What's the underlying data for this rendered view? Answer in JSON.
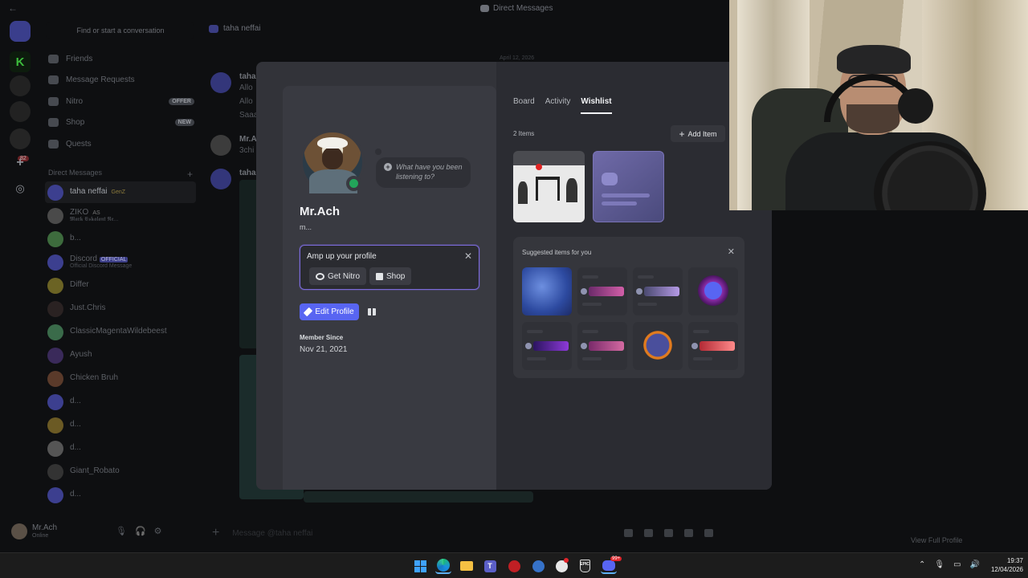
{
  "window": {
    "title": "Direct Messages"
  },
  "sidebar": {
    "search_placeholder": "Find or start a conversation",
    "nav": [
      {
        "label": "Friends"
      },
      {
        "label": "Message Requests"
      },
      {
        "label": "Nitro",
        "pill": "OFFER"
      },
      {
        "label": "Shop",
        "pill": "NEW"
      },
      {
        "label": "Quests"
      }
    ],
    "dm_header": "Direct Messages",
    "dm_add": "+",
    "guild_badge": "82",
    "dms": [
      {
        "name": "taha neffai",
        "tag": "GenZ",
        "active": true
      },
      {
        "name": "ZIKO",
        "tag": "AS",
        "sub": "𝕸𝖆𝖗𝖐 𝕰𝖘𝖐𝖆𝖑𝖆𝖓𝖙 𝕽𝖊..."
      },
      {
        "name": "b..."
      },
      {
        "name": "Discord",
        "badge": "OFFICIAL",
        "sub": "Official Discord Message"
      },
      {
        "name": "Differ"
      },
      {
        "name": "Just.Chris"
      },
      {
        "name": "ClassicMagentaWildebeest"
      },
      {
        "name": "Ayush"
      },
      {
        "name": "Chicken Bruh"
      },
      {
        "name": "d..."
      },
      {
        "name": "d..."
      },
      {
        "name": "d..."
      },
      {
        "name": "Giant_Robato"
      },
      {
        "name": "d..."
      }
    ],
    "user": {
      "name": "Mr.Ach",
      "status": "Online"
    }
  },
  "chat": {
    "recipient": "taha neffai",
    "date_separator": "April 12, 2026",
    "messages": [
      {
        "author": "taha",
        "lines": [
          "Allo",
          "Allo",
          "Saaa"
        ]
      },
      {
        "author": "Mr.A",
        "lines": [
          "3chi"
        ]
      },
      {
        "author": "taha",
        "lines": []
      }
    ],
    "composer_placeholder": "Message @taha neffai",
    "view_full_profile": "View Full Profile"
  },
  "profile": {
    "display_name": "Mr.Ach",
    "username": "m...",
    "now_playing_prompt": "What have you been listening to?",
    "promo": {
      "title": "Amp up your profile",
      "nitro_label": "Get Nitro",
      "shop_label": "Shop"
    },
    "edit_label": "Edit Profile",
    "member_since_label": "Member Since",
    "member_since_value": "Nov 21, 2021",
    "tabs": [
      {
        "label": "Board",
        "active": false
      },
      {
        "label": "Activity",
        "active": false
      },
      {
        "label": "Wishlist",
        "active": true
      }
    ],
    "items_count": "2 Items",
    "add_item_label": "Add Item",
    "suggested_title": "Suggested items for you",
    "accent_color": "#5865f2",
    "status_color": "#23a55a"
  },
  "taskbar": {
    "apps": [
      "windows-start",
      "edge",
      "file-explorer",
      "teams",
      "app-red",
      "app-blue",
      "github-desktop",
      "epic-games",
      "discord"
    ],
    "epic_label": "EPIC",
    "discord_badge": "99+",
    "clock_time": "19:37",
    "clock_date": "12/04/2026"
  }
}
